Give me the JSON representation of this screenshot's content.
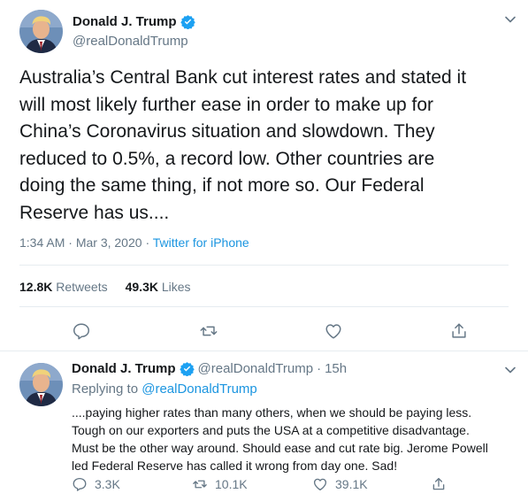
{
  "main_tweet": {
    "author_name": "Donald J. Trump",
    "author_handle": "@realDonaldTrump",
    "text_lines": [
      "Australia’s Central Bank cut interest rates and stated it",
      "will most likely further ease in order to make up for",
      "China’s Coronavirus situation and slowdown. They",
      "reduced to 0.5%, a record low. Other countries are",
      "doing the same thing, if not more so. Our Federal",
      "Reserve has us...."
    ],
    "time": "1:34 AM",
    "date": "Mar 3, 2020",
    "separator": "·",
    "source": "Twitter for iPhone",
    "retweets_count": "12.8K",
    "retweets_label": "Retweets",
    "likes_count": "49.3K",
    "likes_label": "Likes",
    "actions": [
      "reply-icon",
      "retweet-icon",
      "like-icon",
      "share-icon"
    ]
  },
  "reply_tweet": {
    "author_name": "Donald J. Trump",
    "author_handle": "@realDonaldTrump",
    "separator": "·",
    "age": "15h",
    "replying_prefix": "Replying to",
    "replying_to": "@realDonaldTrump",
    "text_lines": [
      "....paying higher rates than many others, when we should be paying less.",
      "Tough on our exporters and puts the USA at a competitive disadvantage.",
      "Must be the other way around. Should ease and cut rate big. Jerome Powell",
      "led Federal Reserve has called it wrong from day one. Sad!"
    ],
    "reply_count": "3.3K",
    "retweet_count": "10.1K",
    "like_count": "39.1K"
  },
  "colors": {
    "text": "#14171a",
    "muted": "#657786",
    "link": "#1b95e0",
    "verified": "#1da1f2",
    "divider": "#e6ecf0"
  }
}
